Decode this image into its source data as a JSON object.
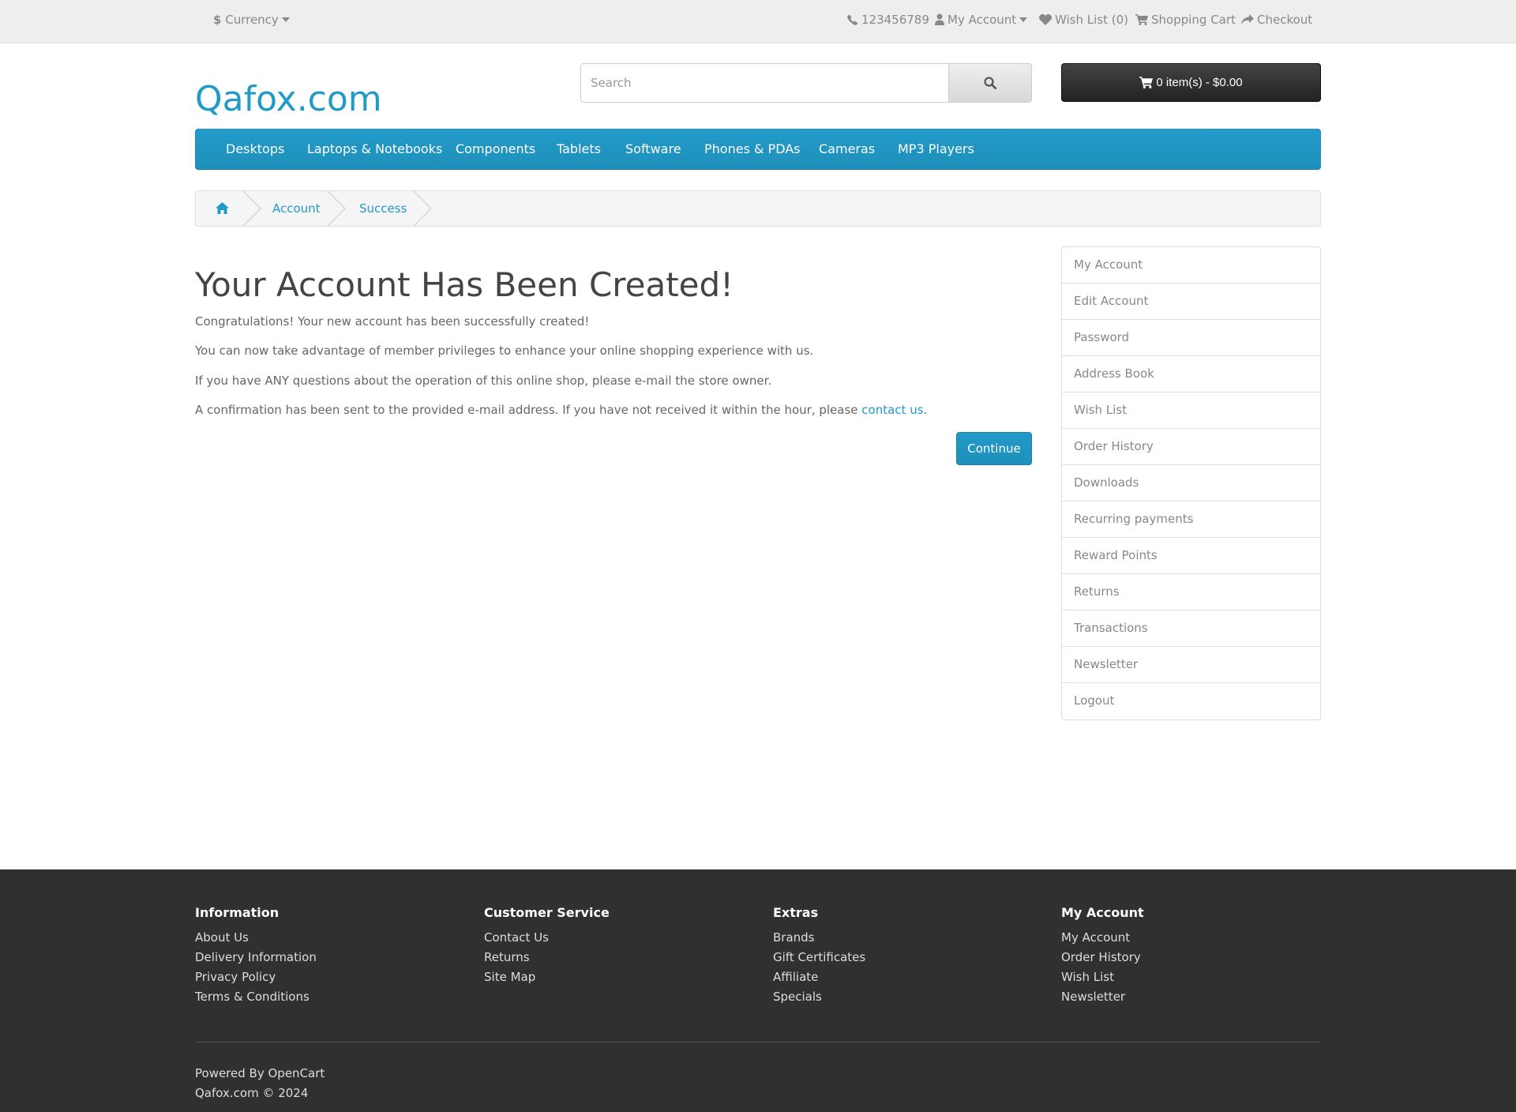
{
  "topbar": {
    "currency_label": "Currency",
    "currency_symbol": "$",
    "phone": "123456789",
    "my_account": "My Account",
    "wish_list": "Wish List (0)",
    "shopping_cart": "Shopping Cart",
    "checkout": "Checkout"
  },
  "header": {
    "logo": "Qafox.com",
    "search_placeholder": "Search",
    "cart_label": "0 item(s) - $0.00"
  },
  "menu": [
    "Desktops",
    "Laptops & Notebooks",
    "Components",
    "Tablets",
    "Software",
    "Phones & PDAs",
    "Cameras",
    "MP3 Players"
  ],
  "breadcrumb": [
    "Account",
    "Success"
  ],
  "content": {
    "title": "Your Account Has Been Created!",
    "p1": "Congratulations! Your new account has been successfully created!",
    "p2": "You can now take advantage of member privileges to enhance your online shopping experience with us.",
    "p3": "If you have ANY questions about the operation of this online shop, please e-mail the store owner.",
    "p4_before": "A confirmation has been sent to the provided e-mail address. If you have not received it within the hour, please ",
    "p4_link": "contact us",
    "p4_after": ".",
    "continue": "Continue"
  },
  "sidebar": [
    "My Account",
    "Edit Account",
    "Password",
    "Address Book",
    "Wish List",
    "Order History",
    "Downloads",
    "Recurring payments",
    "Reward Points",
    "Returns",
    "Transactions",
    "Newsletter",
    "Logout"
  ],
  "footer": {
    "information": {
      "title": "Information",
      "links": [
        "About Us",
        "Delivery Information",
        "Privacy Policy",
        "Terms & Conditions"
      ]
    },
    "customer_service": {
      "title": "Customer Service",
      "links": [
        "Contact Us",
        "Returns",
        "Site Map"
      ]
    },
    "extras": {
      "title": "Extras",
      "links": [
        "Brands",
        "Gift Certificates",
        "Affiliate",
        "Specials"
      ]
    },
    "my_account": {
      "title": "My Account",
      "links": [
        "My Account",
        "Order History",
        "Wish List",
        "Newsletter"
      ]
    },
    "powered_by": "Powered By",
    "powered_link": "OpenCart",
    "copyright": "Qafox.com © 2024"
  },
  "colors": {
    "accent": "#229ac8",
    "footer_bg": "#303030",
    "cart_bg": "#303030"
  }
}
